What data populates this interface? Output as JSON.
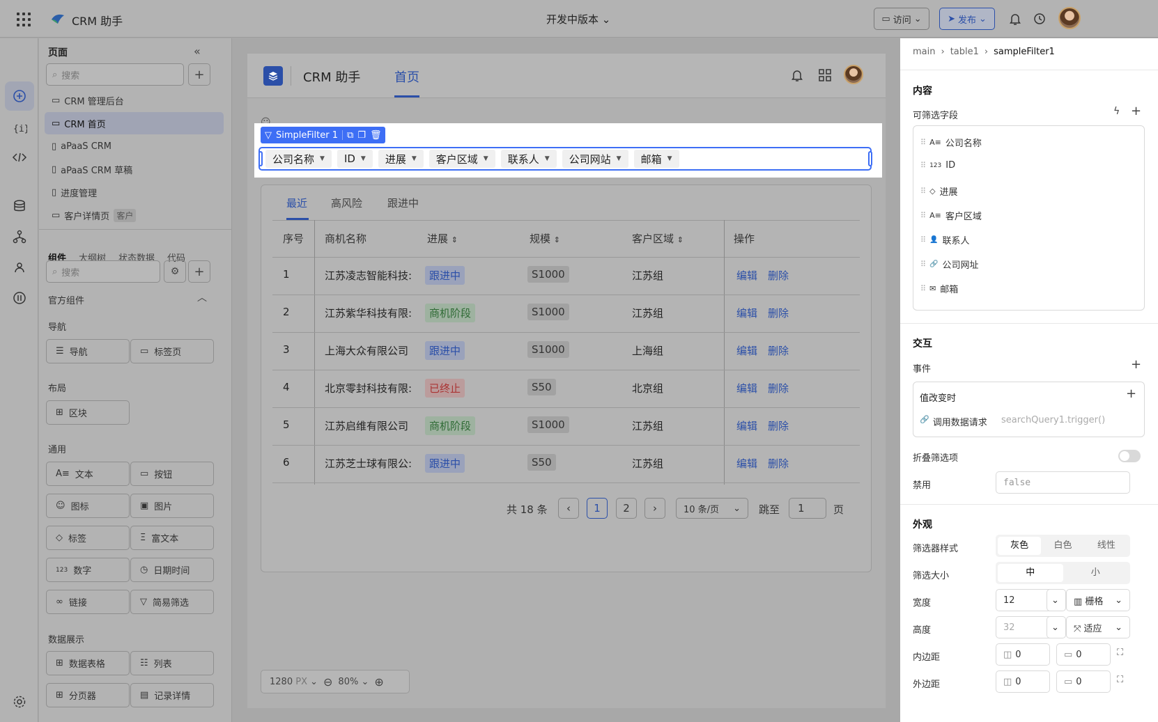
{
  "topbar": {
    "app_name": "CRM 助手",
    "version": "开发中版本",
    "visit_label": "访问",
    "publish_label": "发布"
  },
  "pages_panel": {
    "title": "页面",
    "search_placeholder": "搜索",
    "items": [
      {
        "label": "CRM 管理后台",
        "icon": "monitor-icon"
      },
      {
        "label": "CRM 首页",
        "icon": "monitor-icon",
        "active": true
      },
      {
        "label": "aPaaS CRM",
        "icon": "mobile-icon"
      },
      {
        "label": "aPaaS CRM 草稿",
        "icon": "mobile-icon"
      },
      {
        "label": "进度管理",
        "icon": "mobile-icon"
      },
      {
        "label": "客户详情页",
        "icon": "monitor-icon",
        "tag": "客户"
      }
    ]
  },
  "components_panel": {
    "tabs": [
      "组件",
      "大纲树",
      "状态数据",
      "代码"
    ],
    "search_placeholder": "搜索",
    "official_label": "官方组件",
    "sections": {
      "nav": {
        "title": "导航",
        "items": [
          "导航",
          "标签页"
        ]
      },
      "layout": {
        "title": "布局",
        "items": [
          "区块"
        ]
      },
      "common": {
        "title": "通用",
        "items": [
          "文本",
          "按钮",
          "图标",
          "图片",
          "标签",
          "富文本",
          "数字",
          "日期时间",
          "链接",
          "简易筛选"
        ]
      },
      "data": {
        "title": "数据展示",
        "items": [
          "数据表格",
          "列表",
          "分页器",
          "记录详情"
        ]
      }
    }
  },
  "app": {
    "title": "CRM 助手",
    "tab": "首页",
    "filter_name": "SimpleFilter 1",
    "filter_chips": [
      "公司名称",
      "ID",
      "进展",
      "客户区域",
      "联系人",
      "公司网站",
      "邮箱"
    ],
    "table_tabs": [
      "最近",
      "高风险",
      "跟进中"
    ],
    "columns": [
      "序号",
      "商机名称",
      "进展",
      "规模",
      "客户区域",
      "操作"
    ],
    "rows": [
      {
        "no": "1",
        "name": "江苏凌志智能科技:",
        "status": "跟进中",
        "status_color": "blue",
        "size": "S1000",
        "region": "江苏组"
      },
      {
        "no": "2",
        "name": "江苏紫华科技有限:",
        "status": "商机阶段",
        "status_color": "green",
        "size": "S1000",
        "region": "江苏组"
      },
      {
        "no": "3",
        "name": "上海大众有限公司",
        "status": "跟进中",
        "status_color": "blue",
        "size": "S1000",
        "region": "上海组"
      },
      {
        "no": "4",
        "name": "北京零封科技有限:",
        "status": "已终止",
        "status_color": "red",
        "size": "S50",
        "region": "北京组"
      },
      {
        "no": "5",
        "name": "江苏启维有限公司",
        "status": "商机阶段",
        "status_color": "green",
        "size": "S1000",
        "region": "江苏组"
      },
      {
        "no": "6",
        "name": "江苏芝士球有限公:",
        "status": "跟进中",
        "status_color": "blue",
        "size": "S50",
        "region": "江苏组"
      }
    ],
    "action_edit": "编辑",
    "action_delete": "删除",
    "pager": {
      "total": "共 18 条",
      "pages": [
        "1",
        "2"
      ],
      "current": "1",
      "page_size": "10 条/页",
      "jump_label": "跳至",
      "jump_value": "1",
      "page_unit": "页"
    }
  },
  "zoom": {
    "width": "1280",
    "unit": "PX",
    "zoom": "80%"
  },
  "inspector": {
    "breadcrumb": [
      "main",
      "table1",
      "sampleFilter1"
    ],
    "content_title": "内容",
    "fields_label": "可筛选字段",
    "fields": [
      {
        "icon": "text-icon",
        "glyph": "A≡",
        "label": "公司名称"
      },
      {
        "icon": "number-icon",
        "glyph": "123",
        "label": "ID"
      },
      {
        "icon": "tag-icon",
        "glyph": "◇",
        "label": "进展"
      },
      {
        "icon": "text-icon",
        "glyph": "A≡",
        "label": "客户区域"
      },
      {
        "icon": "user-icon",
        "glyph": "👤",
        "label": "联系人"
      },
      {
        "icon": "link-icon",
        "glyph": "🔗",
        "label": "公司网址"
      },
      {
        "icon": "mail-icon",
        "glyph": "✉",
        "label": "邮箱"
      }
    ],
    "interaction_title": "交互",
    "events_label": "事件",
    "event_name": "值改变时",
    "event_action": "调用数据请求",
    "event_target": "searchQuery1.trigger()",
    "collapse_label": "折叠筛选项",
    "collapse_on": false,
    "disabled_label": "禁用",
    "disabled_value": "false",
    "appearance_title": "外观",
    "style_label": "筛选器样式",
    "style_options": [
      "灰色",
      "白色",
      "线性"
    ],
    "style_selected": "灰色",
    "size_label": "筛选大小",
    "size_options": [
      "中",
      "小"
    ],
    "size_selected": "中",
    "width_label": "宽度",
    "width_value": "12",
    "width_mode": "栅格",
    "height_label": "高度",
    "height_value": "32",
    "height_mode": "适应",
    "padding_label": "内边距",
    "padding_values": [
      "0",
      "0"
    ],
    "margin_label": "外边距",
    "margin_values": [
      "0",
      "0"
    ]
  },
  "colors": {
    "accent": "#3d6ef5",
    "brand": "#2b4fa8"
  }
}
